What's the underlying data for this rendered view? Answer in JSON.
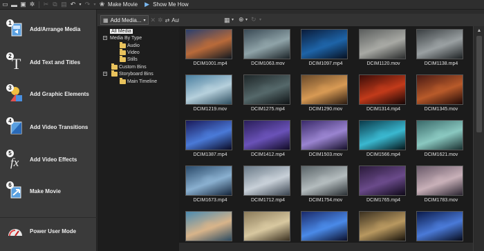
{
  "toolbar": {
    "make_movie_label": "Make Movie",
    "show_me_how_label": "Show Me How"
  },
  "steps": [
    {
      "num": "1",
      "label": "Add/Arrange Media",
      "icon": "film-arrange-icon"
    },
    {
      "num": "2",
      "label": "Add Text and Titles",
      "icon": "text-T-icon"
    },
    {
      "num": "3",
      "label": "Add Graphic Elements",
      "icon": "shapes-icon"
    },
    {
      "num": "4",
      "label": "Add Video Transitions",
      "icon": "transition-icon"
    },
    {
      "num": "5",
      "label": "Add Video Effects",
      "icon": "fx-icon"
    },
    {
      "num": "6",
      "label": "Make Movie",
      "icon": "export-icon"
    }
  ],
  "power_user_label": "Power User Mode",
  "media_bar": {
    "add_media_label": "Add Media...",
    "auto_preview_label": "Auto Preview"
  },
  "tree": {
    "all_media": "All Media",
    "media_by_type": "Media By Type",
    "audio": "Audio",
    "video": "Video",
    "stills": "Stills",
    "custom_bins": "Custom Bins",
    "storyboard_bins": "Storyboard Bins",
    "main_timeline": "Main Timeline"
  },
  "media": [
    {
      "name": "DCIM1001.mp4",
      "colors": [
        "#2a3f6e",
        "#b86a3a",
        "#101820"
      ]
    },
    {
      "name": "DCIM1063.mov",
      "colors": [
        "#3a4a55",
        "#8fa3a8",
        "#1c2428"
      ]
    },
    {
      "name": "DCIM1097.mp4",
      "colors": [
        "#0a1c3a",
        "#1e64a8",
        "#061020"
      ]
    },
    {
      "name": "DCIM1120.mov",
      "colors": [
        "#5c5f5e",
        "#a8a9a4",
        "#2a2c2c"
      ]
    },
    {
      "name": "DCIM1138.mp4",
      "colors": [
        "#3a3f42",
        "#9aa0a2",
        "#1e2224"
      ]
    },
    {
      "name": "DCIM1219.mov",
      "colors": [
        "#4a7fa0",
        "#b6d0dc",
        "#2e4e60"
      ]
    },
    {
      "name": "DCIM1275.mp4",
      "colors": [
        "#1e2628",
        "#55686a",
        "#0e1214"
      ]
    },
    {
      "name": "DCIM1290.mov",
      "colors": [
        "#6a4a2a",
        "#d89a54",
        "#2a1a10"
      ]
    },
    {
      "name": "DCIM1314.mp4",
      "colors": [
        "#3a0c08",
        "#c23a1a",
        "#140404"
      ]
    },
    {
      "name": "DCIM1345.mov",
      "colors": [
        "#4a1a14",
        "#b85a2a",
        "#1e0806"
      ]
    },
    {
      "name": "DCIM1387.mp4",
      "colors": [
        "#1a1a5a",
        "#4a7ad8",
        "#0a0a24"
      ]
    },
    {
      "name": "DCIM1412.mp4",
      "colors": [
        "#2a1e5a",
        "#6a52b8",
        "#100a24"
      ]
    },
    {
      "name": "DCIM1503.mov",
      "colors": [
        "#3a2a6a",
        "#9a84d0",
        "#140e28"
      ]
    },
    {
      "name": "DCIM1566.mp4",
      "colors": [
        "#0a3a4a",
        "#3ab8d0",
        "#041418"
      ]
    },
    {
      "name": "DCIM1621.mov",
      "colors": [
        "#3a6a6a",
        "#8ac8c0",
        "#1a3030"
      ]
    },
    {
      "name": "DCIM1673.mp4",
      "colors": [
        "#2a4a6a",
        "#8ab0d0",
        "#14243a"
      ]
    },
    {
      "name": "DCIM1712.mp4",
      "colors": [
        "#6a7a88",
        "#c8d0d8",
        "#3a4450"
      ]
    },
    {
      "name": "DCIM1754.mov",
      "colors": [
        "#5a6468",
        "#b4bcbe",
        "#2a3034"
      ]
    },
    {
      "name": "DCIM1765.mp4",
      "colors": [
        "#2a1a3a",
        "#6a4a8a",
        "#0e0818"
      ]
    },
    {
      "name": "DCIM1783.mov",
      "colors": [
        "#6a5a6a",
        "#c8b0b8",
        "#2a2430"
      ]
    },
    {
      "name": "",
      "colors": [
        "#4a8ab0",
        "#d8b48a",
        "#2a4a60"
      ]
    },
    {
      "name": "",
      "colors": [
        "#8a7a5a",
        "#d8c8a0",
        "#3a3020"
      ]
    },
    {
      "name": "",
      "colors": [
        "#1a2a6a",
        "#4a8ae8",
        "#0a0e2a"
      ]
    },
    {
      "name": "",
      "colors": [
        "#3a3020",
        "#b89860",
        "#14100a"
      ]
    },
    {
      "name": "",
      "colors": [
        "#0a1a4a",
        "#4a7ad8",
        "#060a1a"
      ]
    }
  ]
}
